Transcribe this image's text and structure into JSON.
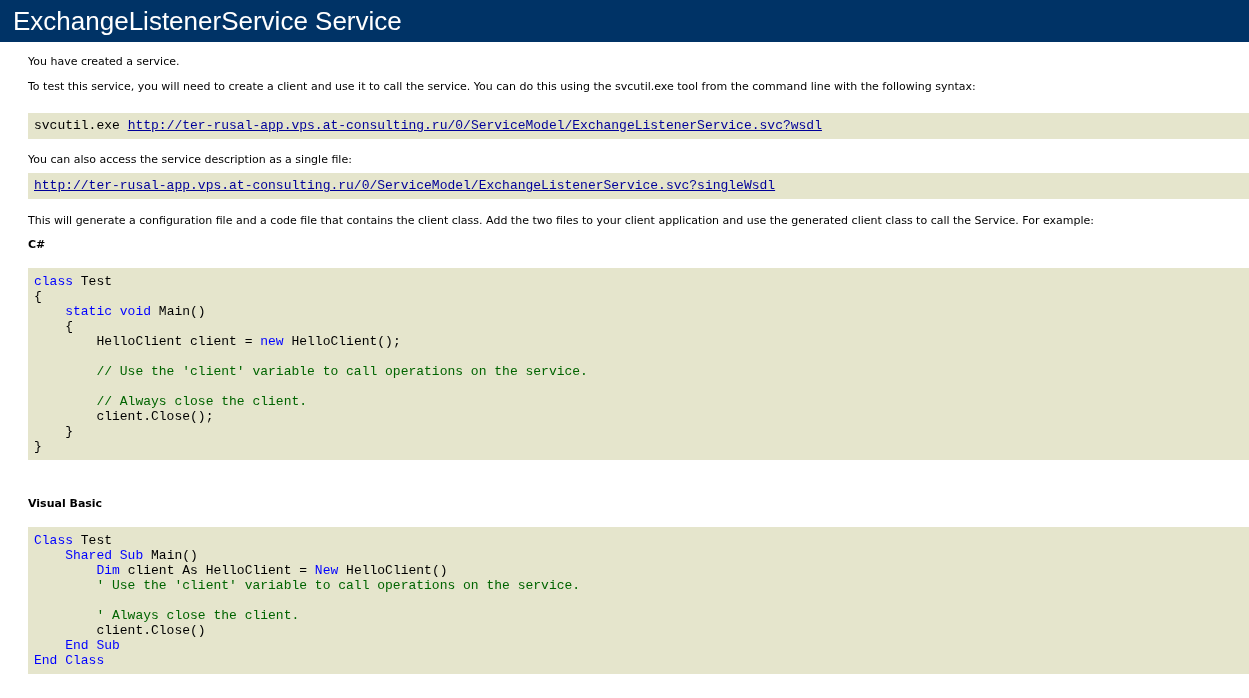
{
  "header": {
    "title": "ExchangeListenerService Service"
  },
  "intro": [
    "You have created a service.",
    "To test this service, you will need to create a client and use it to call the service. You can do this using the svcutil.exe tool from the command line with the following syntax:"
  ],
  "svcutil": {
    "command": "svcutil.exe",
    "link": "http://ter-rusal-app.vps.at-consulting.ru/0/ServiceModel/ExchangeListenerService.svc?wsdl"
  },
  "single_file": {
    "text": "You can also access the service description as a single file:",
    "link": "http://ter-rusal-app.vps.at-consulting.ru/0/ServiceModel/ExchangeListenerService.svc?singleWsdl"
  },
  "generate_text": "This will generate a configuration file and a code file that contains the client class. Add the two files to your client application and use the generated client class to call the Service. For example:",
  "examples": [
    {
      "language": "C#",
      "lines": [
        {
          "gap_before": false,
          "tokens": [
            {
              "kind": "keyword",
              "text": "class "
            },
            {
              "kind": "plain",
              "text": "Test"
            }
          ]
        },
        {
          "gap_before": false,
          "tokens": [
            {
              "kind": "plain",
              "text": "{"
            }
          ]
        },
        {
          "gap_before": false,
          "tokens": [
            {
              "kind": "keyword",
              "text": "    static void "
            },
            {
              "kind": "plain",
              "text": "Main()"
            }
          ]
        },
        {
          "gap_before": false,
          "tokens": [
            {
              "kind": "plain",
              "text": "    {"
            }
          ]
        },
        {
          "gap_before": false,
          "tokens": [
            {
              "kind": "plain",
              "text": "        HelloClient client = "
            },
            {
              "kind": "keyword",
              "text": "new "
            },
            {
              "kind": "plain",
              "text": "HelloClient();"
            }
          ]
        },
        {
          "gap_before": true,
          "tokens": [
            {
              "kind": "comment",
              "text": "        // Use the 'client' variable to call operations on the service."
            }
          ]
        },
        {
          "gap_before": true,
          "tokens": [
            {
              "kind": "comment",
              "text": "        // Always close the client."
            }
          ]
        },
        {
          "gap_before": false,
          "tokens": [
            {
              "kind": "plain",
              "text": "        client.Close();"
            }
          ]
        },
        {
          "gap_before": false,
          "tokens": [
            {
              "kind": "plain",
              "text": "    }"
            }
          ]
        },
        {
          "gap_before": false,
          "tokens": [
            {
              "kind": "plain",
              "text": "}"
            }
          ]
        }
      ]
    },
    {
      "language": "Visual Basic",
      "lines": [
        {
          "gap_before": false,
          "tokens": [
            {
              "kind": "keyword",
              "text": "Class "
            },
            {
              "kind": "plain",
              "text": "Test"
            }
          ]
        },
        {
          "gap_before": false,
          "tokens": [
            {
              "kind": "keyword",
              "text": "    Shared Sub "
            },
            {
              "kind": "plain",
              "text": "Main()"
            }
          ]
        },
        {
          "gap_before": false,
          "tokens": [
            {
              "kind": "keyword",
              "text": "        Dim "
            },
            {
              "kind": "plain",
              "text": "client As HelloClient = "
            },
            {
              "kind": "keyword",
              "text": "New "
            },
            {
              "kind": "plain",
              "text": "HelloClient()"
            }
          ]
        },
        {
          "gap_before": false,
          "tokens": [
            {
              "kind": "comment",
              "text": "        ' Use the 'client' variable to call operations on the service."
            }
          ]
        },
        {
          "gap_before": true,
          "tokens": [
            {
              "kind": "comment",
              "text": "        ' Always close the client."
            }
          ]
        },
        {
          "gap_before": false,
          "tokens": [
            {
              "kind": "plain",
              "text": "        client.Close()"
            }
          ]
        },
        {
          "gap_before": false,
          "tokens": [
            {
              "kind": "keyword",
              "text": "    End Sub"
            }
          ]
        },
        {
          "gap_before": false,
          "tokens": [
            {
              "kind": "keyword",
              "text": "End Class"
            }
          ]
        }
      ]
    }
  ]
}
